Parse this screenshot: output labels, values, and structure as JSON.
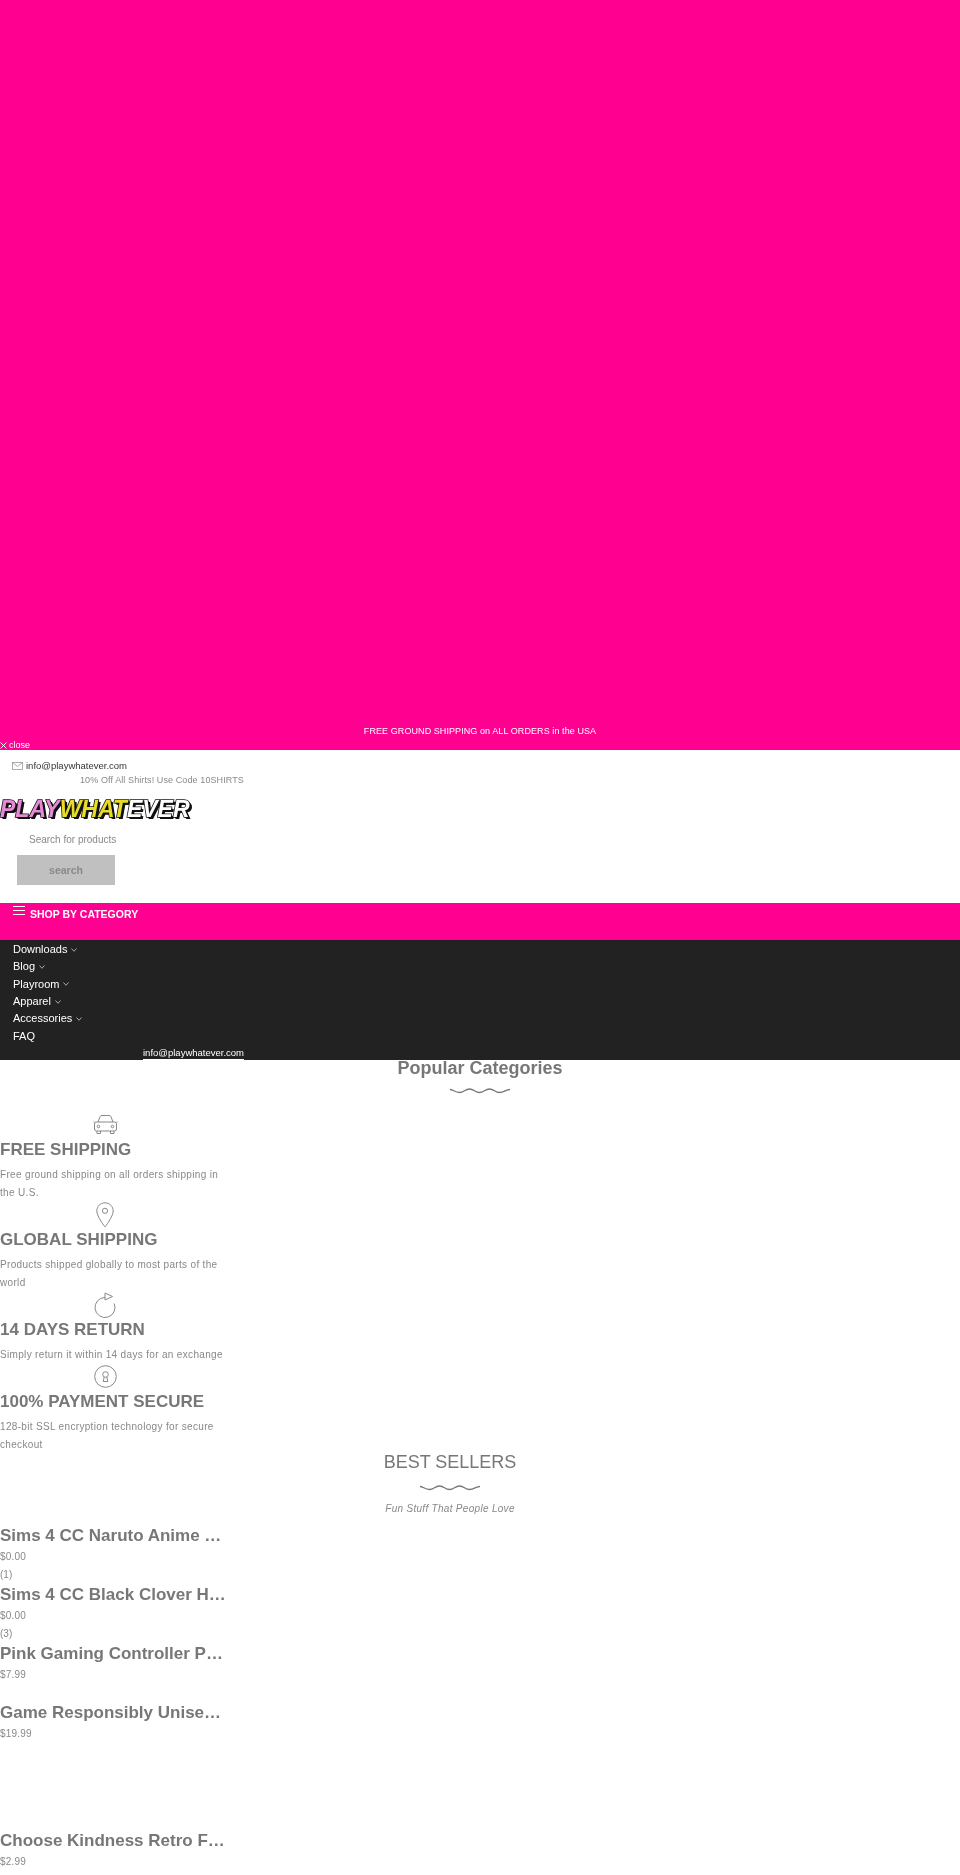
{
  "promo_banner": {
    "text": "FREE GROUND SHIPPING on ALL ORDERS in the USA",
    "close_label": "close"
  },
  "top_bar": {
    "email": "info@playwhatever.com",
    "promo": "10% Off All Shirts! Use Code 10SHIRTS"
  },
  "logo": {
    "parts": [
      {
        "text": "PLAY",
        "color": "#e68ad6"
      },
      {
        "text": "WHAT",
        "color": "#e8dc28"
      },
      {
        "text": "EVER",
        "color": "#ffffff"
      }
    ]
  },
  "search": {
    "placeholder": "Search for products",
    "button": "search"
  },
  "category_bar": {
    "label": "SHOP BY CATEGORY"
  },
  "nav": {
    "items": [
      {
        "label": "Downloads",
        "has_submenu": true
      },
      {
        "label": "Blog",
        "has_submenu": true
      },
      {
        "label": "Playroom",
        "has_submenu": true
      },
      {
        "label": "Apparel",
        "has_submenu": true
      },
      {
        "label": "Accessories",
        "has_submenu": true
      },
      {
        "label": "FAQ",
        "has_submenu": false
      }
    ],
    "email": "info@playwhatever.com"
  },
  "popular_categories": {
    "title": "Popular Categories"
  },
  "features": [
    {
      "kind": "car",
      "title": "FREE SHIPPING",
      "text": "Free ground shipping on all orders shipping in the U.S."
    },
    {
      "kind": "pin",
      "title": "GLOBAL SHIPPING",
      "text": "Products shipped globally to most parts of the world"
    },
    {
      "kind": "return",
      "title": "14 DAYS RETURN",
      "text": "Simply return it within 14 days for an exchange"
    },
    {
      "kind": "secure",
      "title": "100% PAYMENT SECURE",
      "text": "128-bit SSL encryption technology for secure checkout"
    }
  ],
  "best_sellers": {
    "title": "BEST SELLERS",
    "subtitle": "Fun Stuff That People Love",
    "products": [
      {
        "title": "Sims 4 CC Naruto Anime …",
        "price": "$0.00",
        "reviews": "(1)"
      },
      {
        "title": "Sims 4 CC Black Clover H…",
        "price": "$0.00",
        "reviews": "(3)"
      },
      {
        "title": "Pink Gaming Controller P…",
        "price": "$7.99"
      },
      {
        "title": "Game Responsibly Unise…",
        "price": "$19.99"
      },
      {
        "title": "Choose Kindness Retro F…",
        "price": "$2.99"
      }
    ]
  }
}
